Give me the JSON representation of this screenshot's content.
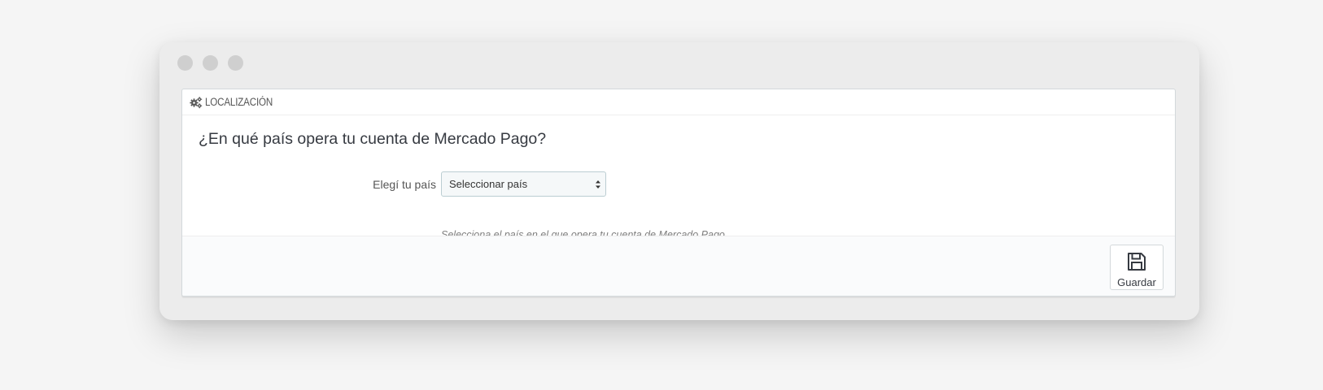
{
  "window": {
    "controls": [
      "close",
      "minimize",
      "maximize"
    ]
  },
  "panel": {
    "heading": {
      "icon": "gears-icon",
      "title": "LOCALIZACIÓN"
    },
    "question": "¿En qué país opera tu cuenta de Mercado Pago?",
    "country_field": {
      "label": "Elegí tu país",
      "selected": "Seleccionar país",
      "help": "Selecciona el país en el que opera tu cuenta de Mercado Pago."
    },
    "footer": {
      "save_icon": "floppy-disk-icon",
      "save_label": "Guardar"
    }
  },
  "colors": {
    "background": "#f5f5f5",
    "window_frame": "#ececec",
    "traffic_light": "#cfcfcf",
    "panel_border": "#d3d8db",
    "select_background": "#f5f8f9",
    "select_border": "#bbcdd2",
    "footer_background": "#fafbfc",
    "text_primary": "#363a41",
    "text_muted": "#7e7e7e"
  }
}
